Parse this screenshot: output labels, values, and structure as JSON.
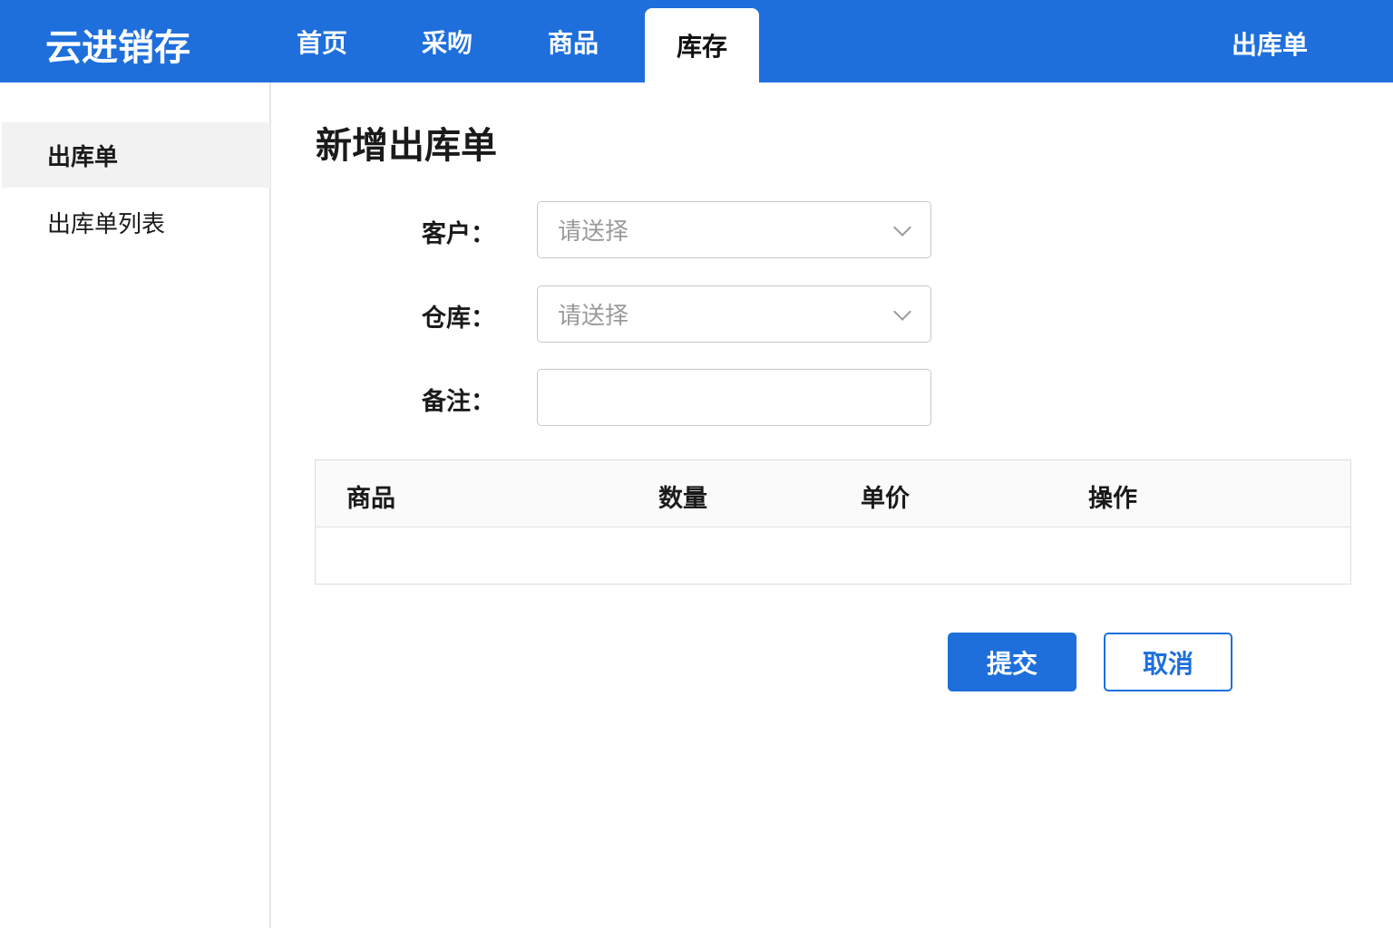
{
  "header": {
    "logo": "云进销存",
    "nav": [
      "首页",
      "采吻",
      "商品",
      "库存"
    ],
    "active_nav": "库存",
    "right_label": "出库单"
  },
  "sidebar": {
    "items": [
      {
        "label": "出库单",
        "active": true
      },
      {
        "label": "出库单列表",
        "active": false
      }
    ]
  },
  "main": {
    "title": "新增出库单",
    "form": {
      "customer_label": "客户：",
      "customer_placeholder": "请送择",
      "warehouse_label": "仓库：",
      "warehouse_placeholder": "请送择",
      "remark_label": "备注：",
      "remark_value": ""
    },
    "table": {
      "columns": [
        "商品",
        "数量",
        "单价",
        "操作"
      ],
      "rows": []
    },
    "submit": "提交",
    "cancel": "取消"
  },
  "colors": {
    "brand": "#1e6fdc"
  }
}
